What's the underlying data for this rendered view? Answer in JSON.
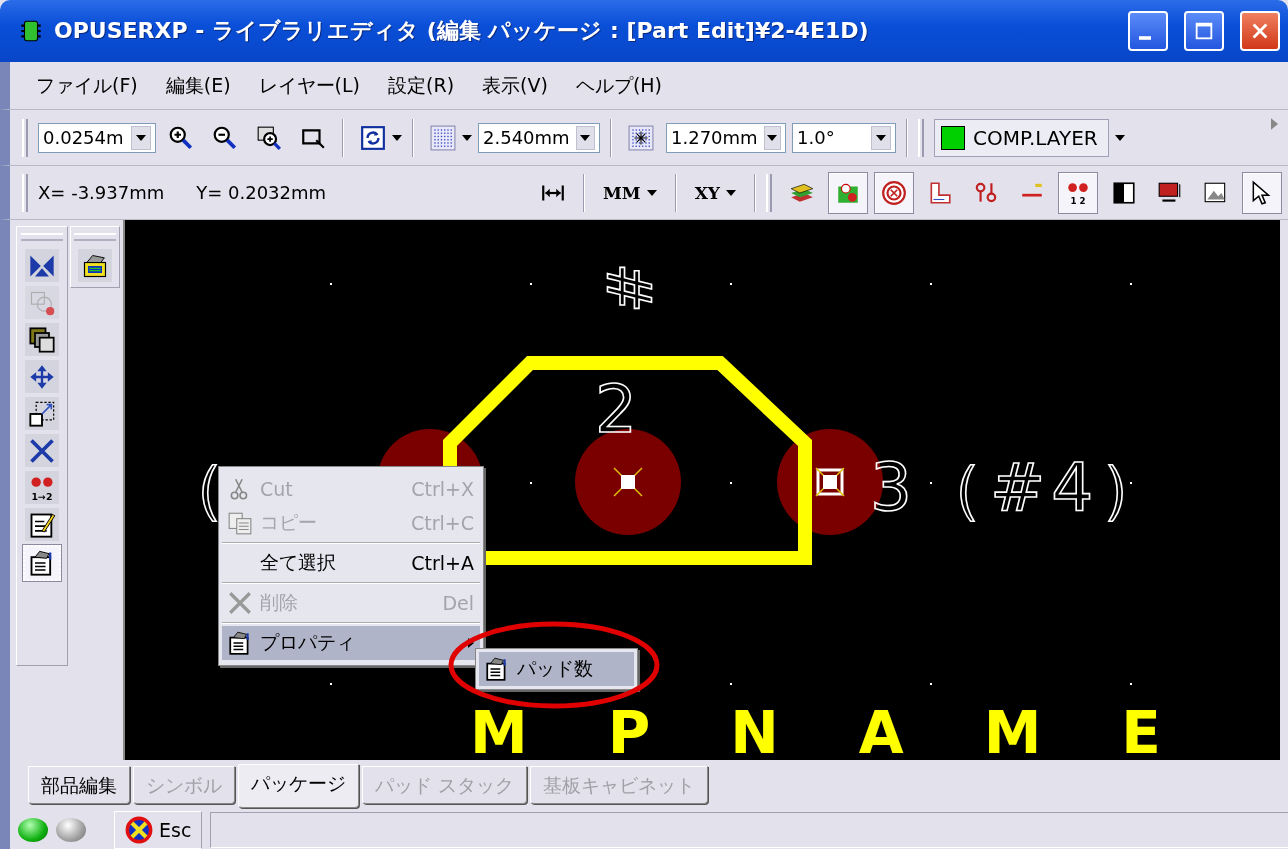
{
  "window": {
    "title": "OPUSERXP - ライブラリエディタ (編集 パッケージ : [Part Edit]¥2-4E1D)"
  },
  "menu": [
    "ファイル(F)",
    "編集(E)",
    "レイヤー(L)",
    "設定(R)",
    "表示(V)",
    "ヘルプ(H)"
  ],
  "toolbar": {
    "zoom_step": "0.0254m",
    "grid": "2.540mm",
    "snap": "1.270mm",
    "angle": "1.0°",
    "layer": "COMP.LAYER"
  },
  "coordinates": {
    "x": "X= -3.937mm",
    "y": "Y= 0.2032mm",
    "unit": "MM",
    "mode": "XY"
  },
  "layer_tools": [
    {
      "selected": false
    },
    {
      "selected": true
    },
    {
      "selected": true
    },
    {
      "selected": false
    },
    {
      "selected": false
    },
    {
      "selected": false
    },
    {
      "selected": true,
      "caption": "1 2"
    },
    {
      "selected": false
    },
    {
      "selected": false
    },
    {
      "selected": false
    },
    {
      "selected": true
    }
  ],
  "left_tools": [
    {
      "selected": false,
      "disabled": false
    },
    {
      "selected": false,
      "disabled": true
    },
    {
      "selected": false,
      "disabled": false
    },
    {
      "selected": false,
      "disabled": false
    },
    {
      "selected": false,
      "disabled": false
    },
    {
      "selected": false,
      "disabled": false
    },
    {
      "selected": false,
      "disabled": false,
      "caption": "1→2"
    },
    {
      "selected": false,
      "disabled": false
    },
    {
      "selected": true,
      "disabled": false
    }
  ],
  "canvas": {
    "left_label": "（",
    "pad_label": "2",
    "right_label": "3（#4）",
    "rotated_label": "#",
    "part_name": "MPNAME"
  },
  "context_menu": {
    "groups": [
      {
        "items": [
          {
            "label": "Cut",
            "shortcut": "Ctrl+X",
            "disabled": true,
            "selected": false
          },
          {
            "label": "コピー",
            "shortcut": "Ctrl+C",
            "disabled": true,
            "selected": false
          }
        ]
      },
      {
        "items": [
          {
            "label": "全て選択",
            "shortcut": "Ctrl+A",
            "disabled": false,
            "selected": false
          }
        ]
      },
      {
        "items": [
          {
            "label": "削除",
            "shortcut": "Del",
            "disabled": true,
            "selected": false
          }
        ]
      },
      {
        "items": [
          {
            "label": "プロパティ",
            "disabled": false,
            "selected": true
          }
        ]
      }
    ],
    "submenu": [
      {
        "label": "パッド数",
        "selected": true
      }
    ]
  },
  "tabs": [
    {
      "label": "部品編集",
      "selected": false,
      "disabled": false
    },
    {
      "label": "シンボル",
      "selected": false,
      "disabled": true
    },
    {
      "label": "パッケージ",
      "selected": true,
      "disabled": false
    },
    {
      "label": "パッド スタック",
      "selected": false,
      "disabled": true
    },
    {
      "label": "基板キャビネット",
      "selected": false,
      "disabled": true
    }
  ],
  "status": {
    "lights": [
      {
        "on": true
      },
      {
        "on": false
      }
    ],
    "esc": "Esc"
  }
}
